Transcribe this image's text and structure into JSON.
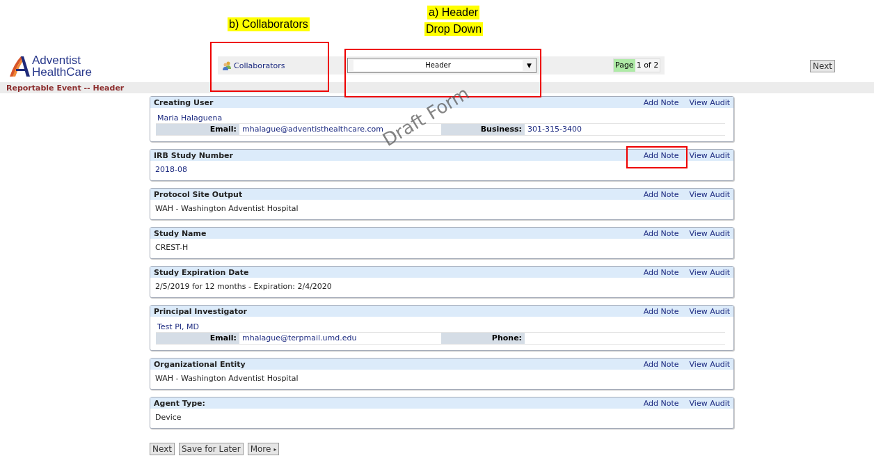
{
  "annotations": {
    "collaborators": "b) Collaborators",
    "dropdown": [
      "a) Header",
      "Drop Down"
    ]
  },
  "logo": {
    "line1": "Adventist",
    "line2": "HealthCare"
  },
  "toolbar": {
    "collaborators": "Collaborators",
    "dropdown": {
      "value": "Header",
      "arrow": "▼"
    },
    "page": {
      "label": "Page",
      "value": "1 of 2"
    },
    "next": "Next"
  },
  "page_title": "Reportable Event -- Header",
  "watermark": "Draft Form",
  "sections": [
    {
      "kind": "contact",
      "title": "Creating User",
      "add_note": "Add Note",
      "view_audit": "View Audit",
      "add_note_highlighted": false,
      "name": "Maria Halaguena",
      "fields": [
        {
          "label": "Email:",
          "value": "mhalague@adventisthealthcare.com"
        },
        {
          "label": "Business:",
          "value": "301-315-3400"
        }
      ]
    },
    {
      "kind": "text",
      "title": "IRB Study Number",
      "add_note": "Add Note",
      "view_audit": "View Audit",
      "add_note_highlighted": true,
      "value": "2018-08",
      "linked": true
    },
    {
      "kind": "text",
      "title": "Protocol Site Output",
      "add_note": "Add Note",
      "view_audit": "View Audit",
      "add_note_highlighted": false,
      "value": "WAH - Washington Adventist Hospital",
      "linked": false
    },
    {
      "kind": "text",
      "title": "Study Name",
      "add_note": "Add Note",
      "view_audit": "View Audit",
      "add_note_highlighted": false,
      "value": "CREST-H",
      "linked": false
    },
    {
      "kind": "text",
      "title": "Study Expiration Date",
      "add_note": "Add Note",
      "view_audit": "View Audit",
      "add_note_highlighted": false,
      "value": "2/5/2019 for 12 months - Expiration: 2/4/2020",
      "linked": false
    },
    {
      "kind": "contact",
      "title": "Principal Investigator",
      "add_note": "Add Note",
      "view_audit": "View Audit",
      "add_note_highlighted": false,
      "name": "Test PI, MD",
      "fields": [
        {
          "label": "Email:",
          "value": "mhalague@terpmail.umd.edu"
        },
        {
          "label": "Phone:"
        }
      ]
    },
    {
      "kind": "text",
      "title": "Organizational Entity",
      "add_note": "Add Note",
      "view_audit": "View Audit",
      "add_note_highlighted": false,
      "value": "WAH - Washington Adventist Hospital",
      "linked": false
    },
    {
      "kind": "text",
      "title": "Agent Type:",
      "add_note": "Add Note",
      "view_audit": "View Audit",
      "add_note_highlighted": false,
      "value": "Device",
      "linked": false
    }
  ],
  "buttons": [
    {
      "label": "Next",
      "kind": "plain"
    },
    {
      "label": "Save for Later",
      "kind": "plain"
    },
    {
      "label": "More",
      "kind": "menu",
      "arrow": "▸"
    }
  ]
}
